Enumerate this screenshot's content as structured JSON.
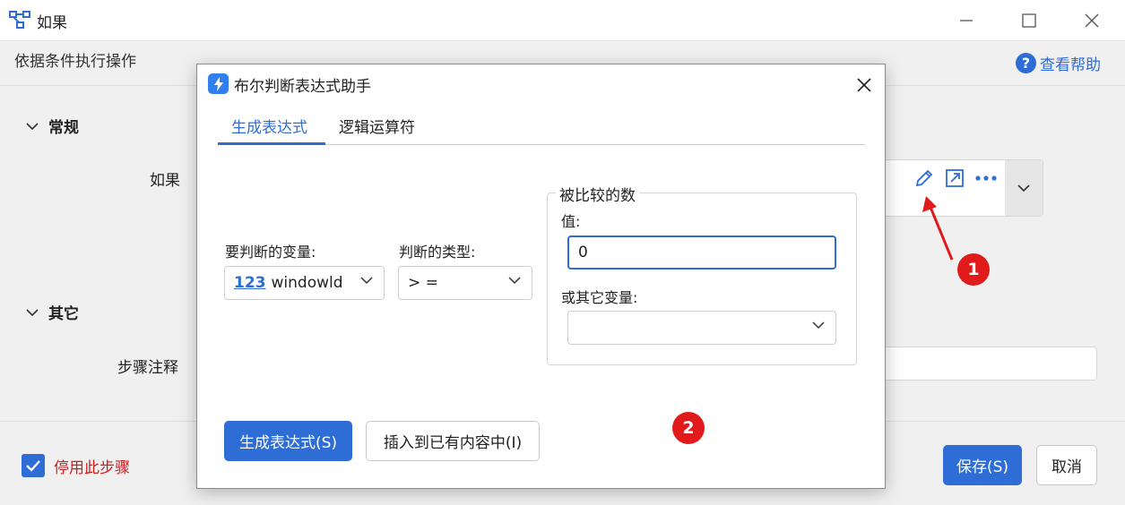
{
  "window": {
    "title": "如果",
    "subtitle": "依据条件执行操作",
    "help_label": "查看帮助"
  },
  "sections": {
    "general": "常规",
    "other": "其它"
  },
  "fields": {
    "if_label": "如果",
    "note_label": "步骤注释"
  },
  "footer": {
    "disable_label": "停用此步骤",
    "disable_checked": true,
    "save": "保存(S)",
    "cancel": "取消"
  },
  "dialog": {
    "title": "布尔判断表达式助手",
    "tabs": [
      "生成表达式",
      "逻辑运算符"
    ],
    "active_tab": 0,
    "var_label": "要判断的变量:",
    "var_value": "windowld",
    "var_type_icon": "123",
    "type_label": "判断的类型:",
    "type_value": "> =",
    "group_title": "被比较的数",
    "value_label": "值:",
    "value_input": "0",
    "other_var_label": "或其它变量:",
    "other_var_value": "",
    "generate_btn": "生成表达式(S)",
    "insert_btn": "插入到已有内容中(I)"
  },
  "annotations": {
    "marker1": "1",
    "marker2": "2"
  },
  "colors": {
    "accent": "#2f6dd6",
    "danger": "#e11b1b"
  }
}
